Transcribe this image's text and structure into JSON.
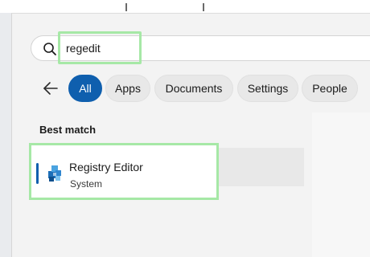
{
  "search": {
    "query": "regedit"
  },
  "filters": [
    {
      "label": "All",
      "active": true
    },
    {
      "label": "Apps"
    },
    {
      "label": "Documents"
    },
    {
      "label": "Settings"
    },
    {
      "label": "People"
    }
  ],
  "results": {
    "heading": "Best match",
    "best_match": {
      "title": "Registry Editor",
      "subtitle": "System",
      "icon": "registry-editor-icon"
    }
  },
  "colors": {
    "accent": "#0f5fae",
    "highlight": "#a6e8a6"
  }
}
